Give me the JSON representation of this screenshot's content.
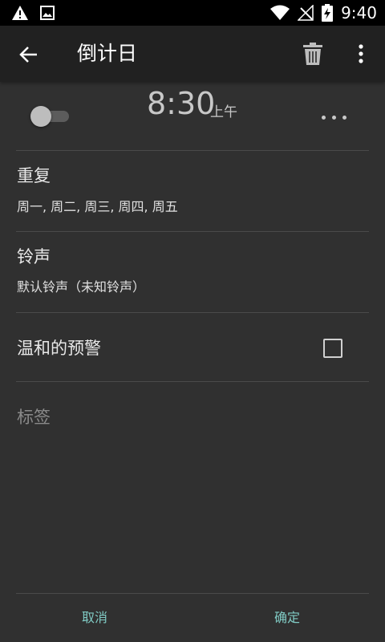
{
  "status_bar": {
    "time": "9:40",
    "icons": [
      "warning-icon",
      "image-icon",
      "wifi-icon",
      "signal-icon",
      "battery-charging-icon"
    ]
  },
  "app_bar": {
    "title": "倒计日",
    "back_icon": "arrow-back-icon",
    "delete_icon": "trash-icon",
    "more_icon": "more-vertical-icon"
  },
  "alarm": {
    "enabled": false,
    "time": "8:30",
    "ampm": "上午",
    "options_icon": "more-horizontal-icon"
  },
  "repeat": {
    "title": "重复",
    "value": "周一, 周二, 周三, 周四, 周五"
  },
  "ringtone": {
    "title": "铃声",
    "value": "默认铃声（未知铃声）"
  },
  "gentle_alarm": {
    "title": "温和的预警",
    "checked": false
  },
  "label": {
    "placeholder": "标签"
  },
  "footer": {
    "cancel_label": "取消",
    "confirm_label": "确定"
  },
  "colors": {
    "background": "#303030",
    "app_bar": "#212121",
    "accent": "#80cbc4"
  }
}
